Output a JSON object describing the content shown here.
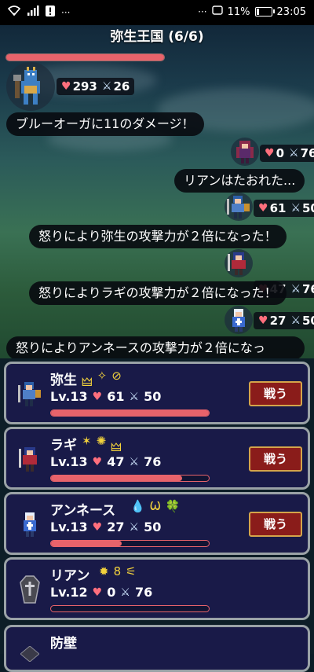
{
  "status_bar": {
    "left_icons": [
      "wifi-icon",
      "signal-icon",
      "alert-icon",
      "more-icon"
    ],
    "dots": "···",
    "right_dots": "···",
    "battery_percent": "11%",
    "time": "23:05"
  },
  "battle": {
    "title": "弥生王国 (6/6)",
    "enemy": {
      "hp": "293",
      "atk": "26",
      "hp_fraction": 1.0
    },
    "messages": [
      "ブルーオーガに11のダメージ！",
      "リアンはたおれた...",
      "怒りにより弥生の攻撃力が２倍になった！",
      "怒りによりラギの攻撃力が２倍になった！",
      "怒りによりアンネースの攻撃力が２倍になっ"
    ],
    "chips": [
      {
        "hp": "0",
        "atk": "76"
      },
      {
        "hp": "61",
        "atk": "50"
      },
      {
        "hp": "47",
        "atk": "76"
      },
      {
        "hp": "27",
        "atk": "50"
      }
    ]
  },
  "party": [
    {
      "name": "弥生",
      "level": "Lv.13",
      "hp": "61",
      "atk": "50",
      "hp_fraction": 1.0,
      "fight_label": "戦う",
      "icons": [
        "🜲",
        "✧",
        "⊘"
      ]
    },
    {
      "name": "ラギ",
      "level": "Lv.13",
      "hp": "47",
      "atk": "76",
      "hp_fraction": 0.83,
      "fight_label": "戦う",
      "icons": [
        "✶",
        "✺",
        "🜲"
      ]
    },
    {
      "name": "アンネース",
      "level": "Lv.13",
      "hp": "27",
      "atk": "50",
      "hp_fraction": 0.45,
      "fight_label": "戦う",
      "icons": [
        "💧",
        "Ѡ",
        "🍀"
      ]
    },
    {
      "name": "リアン",
      "level": "Lv.12",
      "hp": "0",
      "atk": "76",
      "hp_fraction": 0.0,
      "icons": [
        "✹",
        "8",
        "⚟"
      ]
    },
    {
      "name": "防壁"
    }
  ],
  "colors": {
    "hp": "#e8636b",
    "panel": "#191a48",
    "fight_button": "#8a1c1a"
  }
}
